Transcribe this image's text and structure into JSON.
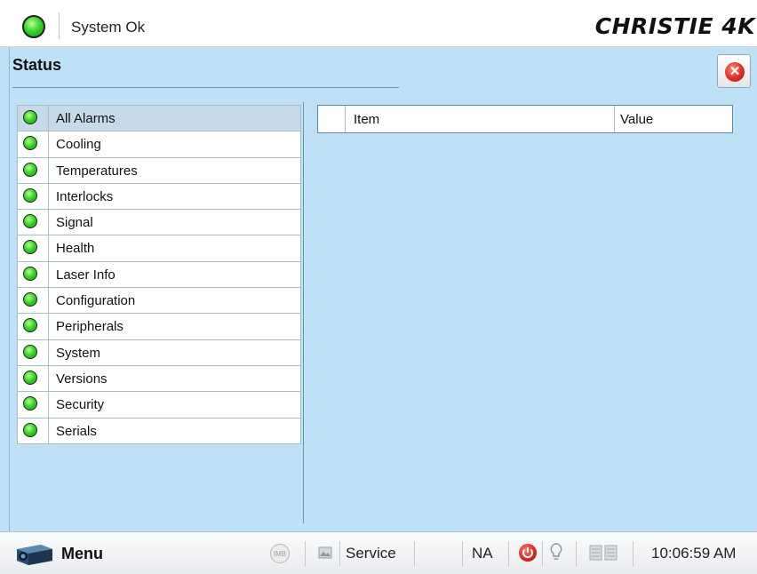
{
  "header": {
    "status_text": "System Ok",
    "status_indicator": "ok",
    "logo_text": "CHRISTIE 4K"
  },
  "page": {
    "title": "Status",
    "close_icon": "close-icon"
  },
  "categories": [
    {
      "label": "All Alarms",
      "state": "ok",
      "selected": true
    },
    {
      "label": "Cooling",
      "state": "ok"
    },
    {
      "label": "Temperatures",
      "state": "ok"
    },
    {
      "label": "Interlocks",
      "state": "ok"
    },
    {
      "label": "Signal",
      "state": "ok"
    },
    {
      "label": "Health",
      "state": "ok"
    },
    {
      "label": "Laser Info",
      "state": "ok"
    },
    {
      "label": "Configuration",
      "state": "ok"
    },
    {
      "label": "Peripherals",
      "state": "ok"
    },
    {
      "label": "System",
      "state": "ok"
    },
    {
      "label": "Versions",
      "state": "ok"
    },
    {
      "label": "Security",
      "state": "ok"
    },
    {
      "label": "Serials",
      "state": "ok"
    }
  ],
  "detail_table": {
    "columns": [
      "Item",
      "Value"
    ],
    "rows": []
  },
  "statusbar": {
    "menu_label": "Menu",
    "imb_label": "IMB",
    "service_label": "Service",
    "na_label": "NA",
    "time": "10:06:59 AM"
  },
  "colors": {
    "background": "#bfe1f5",
    "ok_green": "#39d62c",
    "alert_red": "#dc2a20",
    "selected_row": "#c7daea"
  }
}
